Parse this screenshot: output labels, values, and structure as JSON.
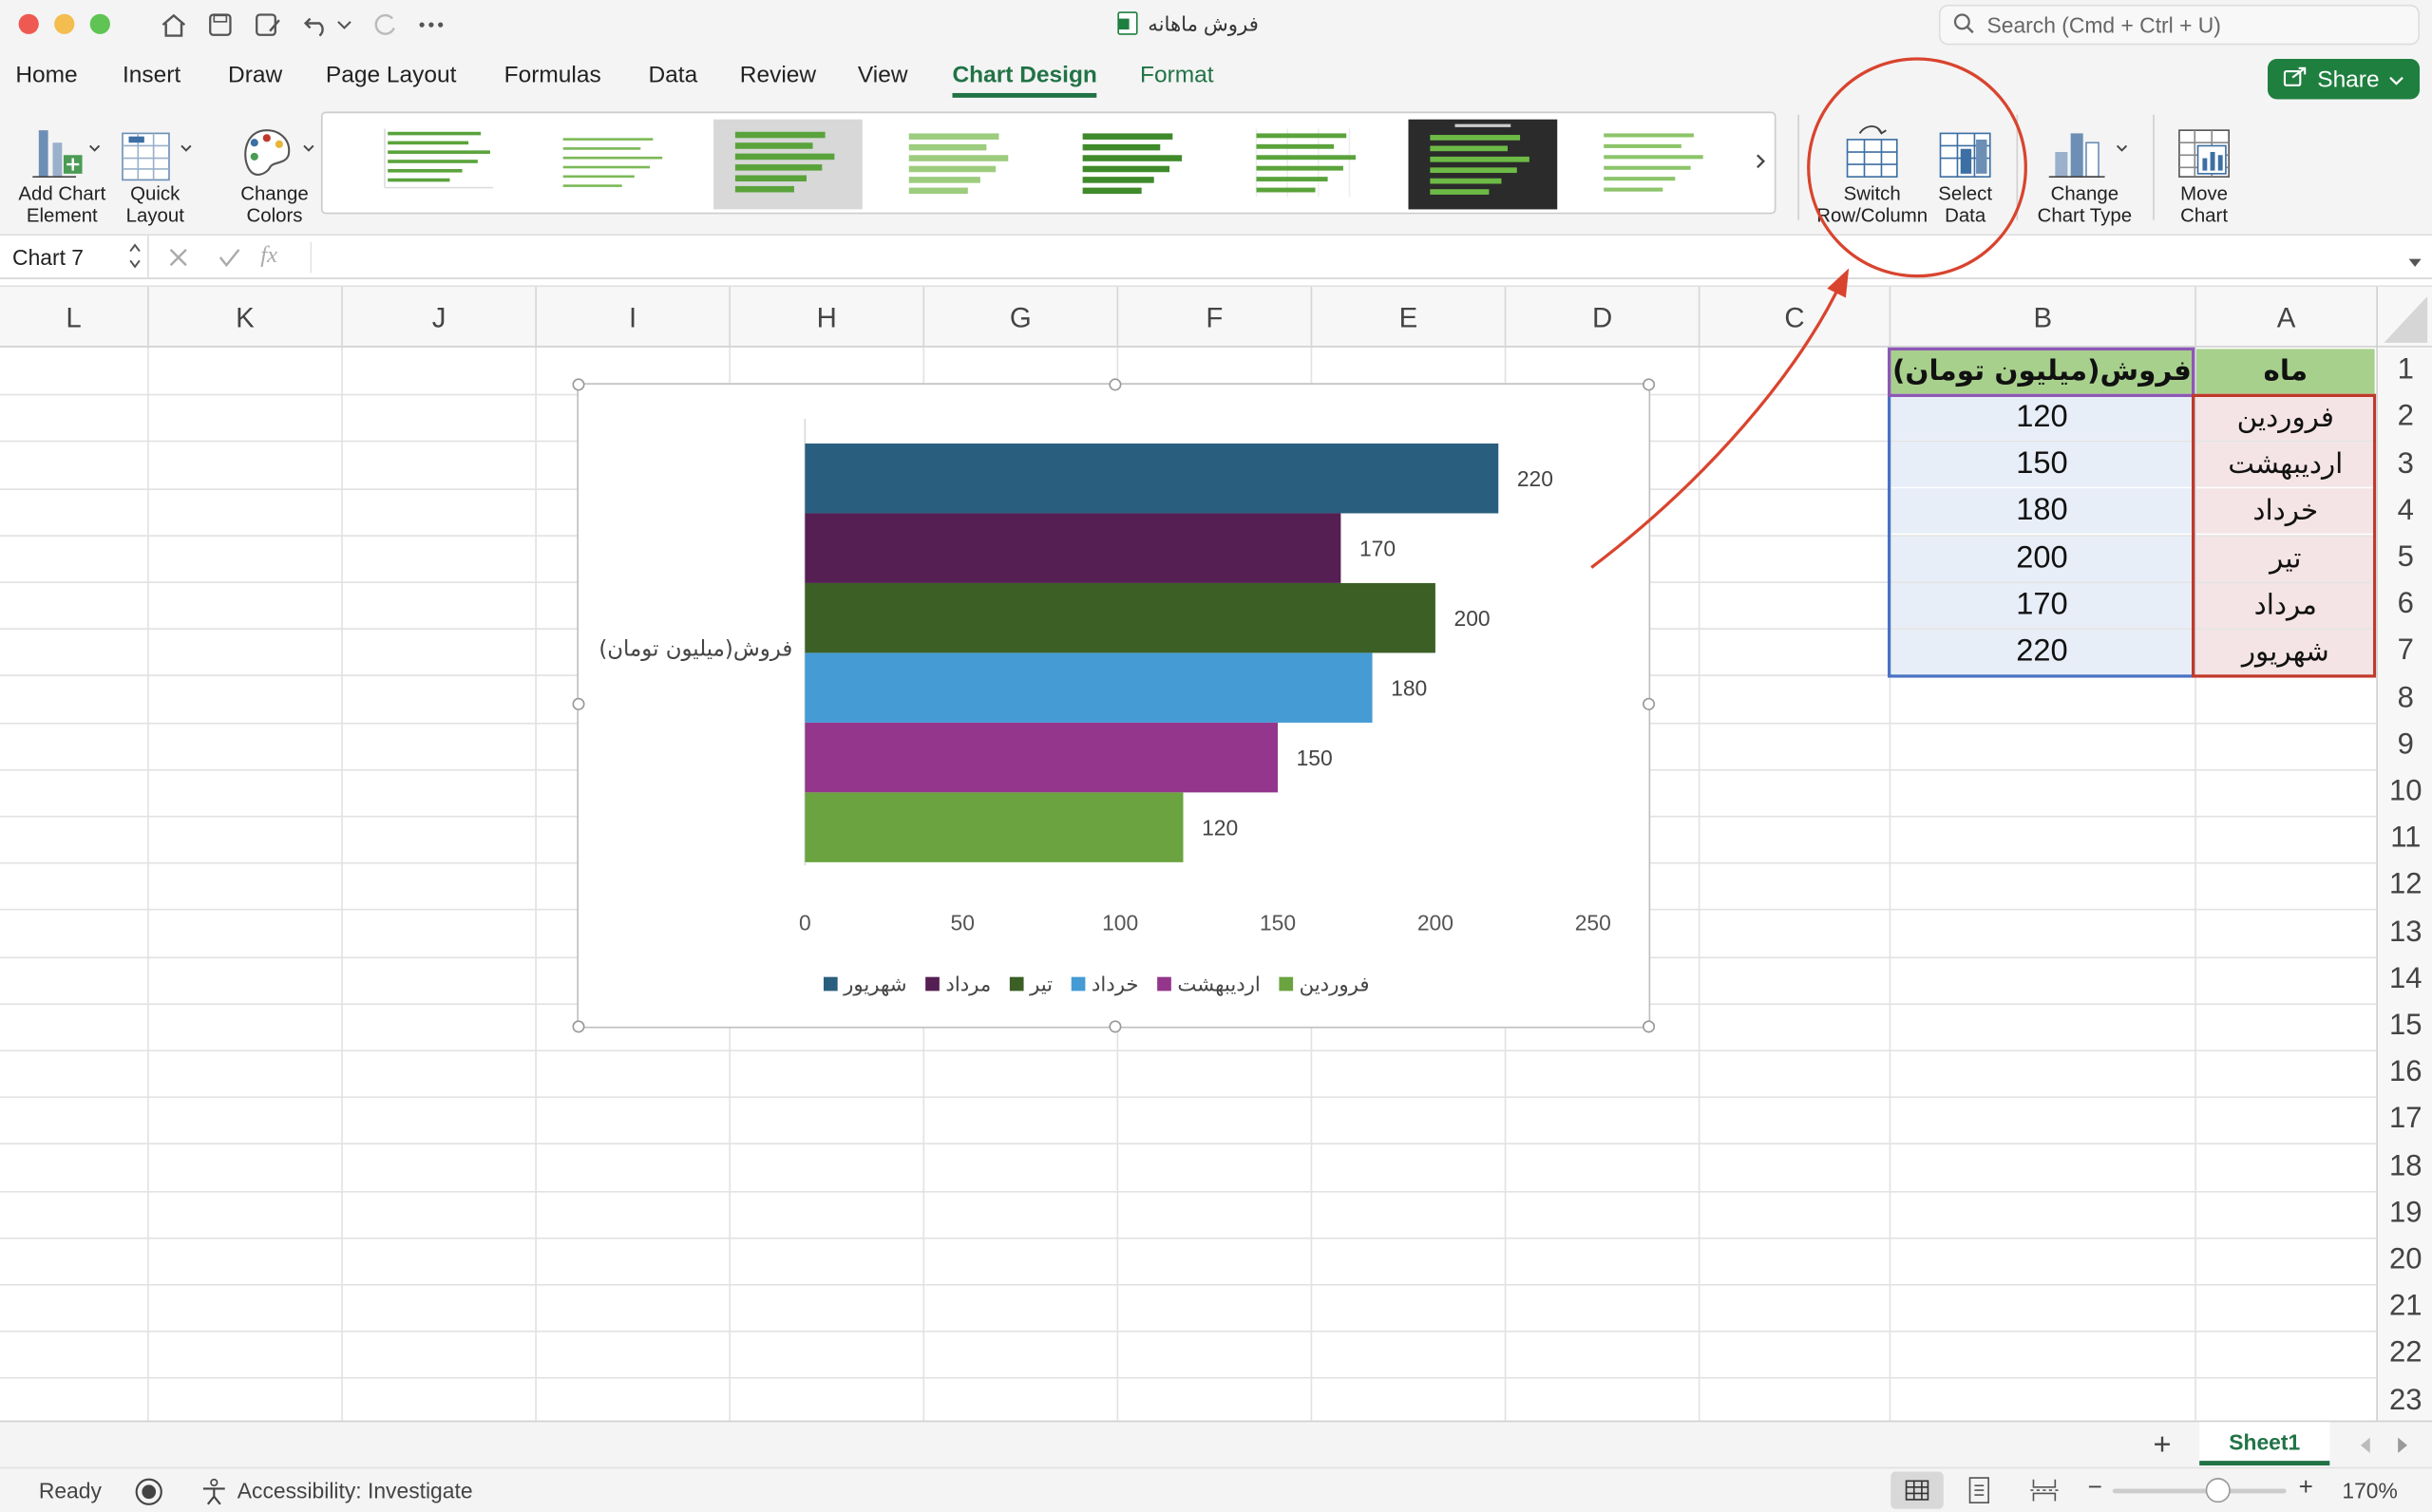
{
  "window": {
    "doc_title": "فروش ماهانه",
    "search_placeholder": "Search (Cmd + Ctrl + U)"
  },
  "tabs": [
    "Home",
    "Insert",
    "Draw",
    "Page Layout",
    "Formulas",
    "Data",
    "Review",
    "View",
    "Chart Design",
    "Format"
  ],
  "active_tab": "Chart Design",
  "share_label": "Share",
  "ribbon": {
    "add_chart_element": [
      "Add Chart",
      "Element"
    ],
    "quick_layout": [
      "Quick",
      "Layout"
    ],
    "change_colors": [
      "Change",
      "Colors"
    ],
    "switch_row_column": [
      "Switch",
      "Row/Column"
    ],
    "select_data": [
      "Select",
      "Data"
    ],
    "change_chart_type": [
      "Change",
      "Chart Type"
    ],
    "move_chart": [
      "Move",
      "Chart"
    ]
  },
  "formula_bar": {
    "name_box": "Chart 7",
    "fx": "fx"
  },
  "columns": [
    "L",
    "K",
    "J",
    "I",
    "H",
    "G",
    "F",
    "E",
    "D",
    "C",
    "B",
    "A"
  ],
  "rows": [
    "1",
    "2",
    "3",
    "4",
    "5",
    "6",
    "7",
    "8",
    "9",
    "10",
    "11",
    "12",
    "13",
    "14",
    "15",
    "16",
    "17",
    "18",
    "19",
    "20",
    "21",
    "22",
    "23"
  ],
  "table": {
    "header_a": "ماه",
    "header_b": "فروش(میلیون تومان)",
    "months": [
      "فروردین",
      "اردیبهشت",
      "خرداد",
      "تیر",
      "مرداد",
      "شهریور"
    ],
    "sales": [
      "120",
      "150",
      "180",
      "200",
      "170",
      "220"
    ]
  },
  "chart_data": {
    "type": "bar",
    "orientation": "horizontal",
    "category_label": "فروش(میلیون تومان)",
    "series": [
      {
        "name": "فروردین",
        "value": 120,
        "color": "#6aa33f"
      },
      {
        "name": "اردیبهشت",
        "value": 150,
        "color": "#93368c"
      },
      {
        "name": "خرداد",
        "value": 180,
        "color": "#459bd4"
      },
      {
        "name": "تیر",
        "value": 200,
        "color": "#3b5f25"
      },
      {
        "name": "مرداد",
        "value": 170,
        "color": "#561f53"
      },
      {
        "name": "شهریور",
        "value": 220,
        "color": "#2a5e7e"
      }
    ],
    "xticks": [
      "0",
      "50",
      "100",
      "150",
      "200",
      "250"
    ],
    "xlim": [
      0,
      250
    ],
    "legend_position": "bottom",
    "data_labels": true
  },
  "sheet_tab": "Sheet1",
  "add_sheet": "+",
  "status": {
    "ready": "Ready",
    "accessibility": "Accessibility: Investigate",
    "zoom": "170%"
  },
  "annotation_color": "#d9442e"
}
